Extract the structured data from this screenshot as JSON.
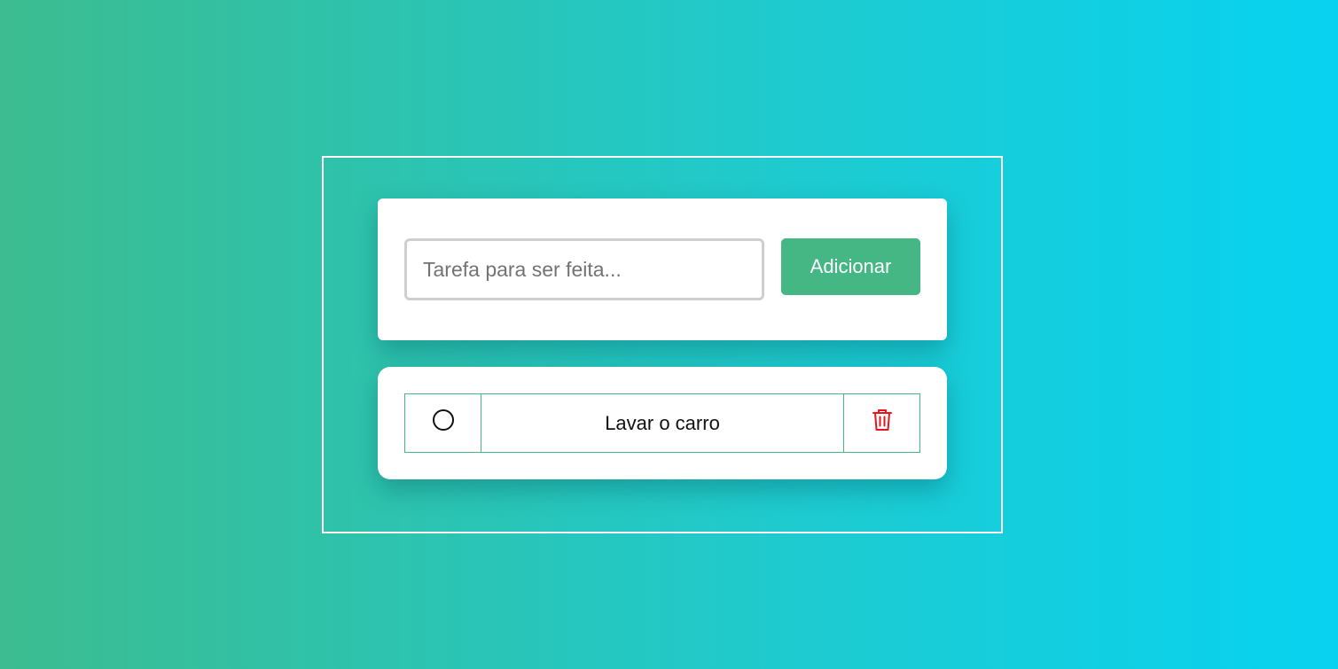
{
  "add_form": {
    "placeholder": "Tarefa para ser feita...",
    "value": "",
    "button_label": "Adicionar"
  },
  "tasks": [
    {
      "text": "Lavar o carro",
      "completed": false,
      "status_icon": "circle-outline-icon",
      "delete_icon": "trash-icon"
    }
  ],
  "colors": {
    "accent": "#44b785",
    "delete": "#e8141c",
    "gradient_start": "#3cbc8f",
    "gradient_end": "#07d2f0"
  }
}
